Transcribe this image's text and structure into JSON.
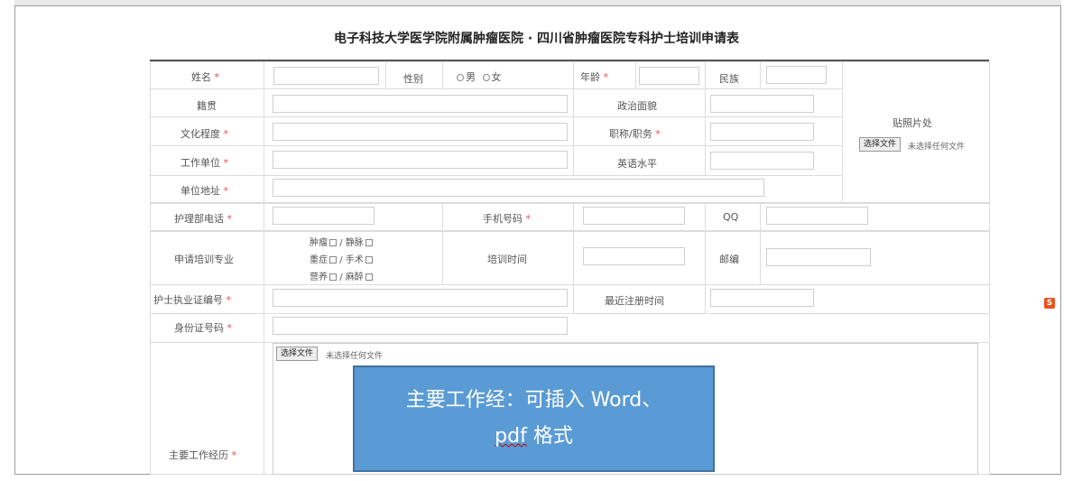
{
  "form": {
    "title": "电子科技大学医学院附属肿瘤医院 · 四川省肿瘤医院专科护士培训申请表",
    "required_mark": "*",
    "fields": {
      "name": "姓名",
      "gender": "性别",
      "gender_male": "男",
      "gender_female": "女",
      "age": "年龄",
      "ethnicity": "民族",
      "native_place": "籍贯",
      "political_status": "政治面貌",
      "photo": "贴照片处",
      "education": "文化程度",
      "title_position": "职称/职务",
      "work_unit": "工作单位",
      "english_level": "英语水平",
      "unit_address": "单位地址",
      "nursing_dept_phone": "护理部电话",
      "mobile": "手机号码",
      "qq": "QQ",
      "specialty": "申请培训专业",
      "specialty_options": {
        "tumor": "肿瘤",
        "vein": "/ 静脉",
        "icu": "重症",
        "surgery": "/ 手术",
        "nutrition": "营养",
        "anesthesia": "/ 麻醉"
      },
      "training_time": "培训时间",
      "postcode": "邮编",
      "license_no": "护士执业证编号",
      "recent_registration": "最近注册时间",
      "id_number": "身份证号码",
      "work_experience": "主要工作经历"
    },
    "file_button": "选择文件",
    "file_status": "未选择任何文件"
  },
  "callout": {
    "line1_a": "主要工作经：可插入",
    "line1_b": "Word、",
    "line2_a": "pdf",
    "line2_b": "格式"
  },
  "side_icon": "S"
}
